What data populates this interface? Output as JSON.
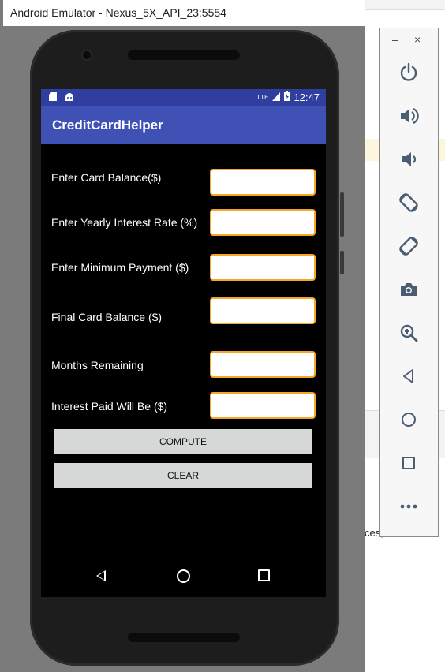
{
  "window": {
    "title": "Android Emulator - Nexus_5X_API_23:5554"
  },
  "status_bar": {
    "network": "LTE",
    "time": "12:47"
  },
  "app": {
    "title": "CreditCardHelper"
  },
  "form": {
    "card_balance": {
      "label": "Enter Card Balance($)",
      "value": ""
    },
    "interest_rate": {
      "label": "Enter Yearly Interest Rate (%)",
      "value": ""
    },
    "minimum_payment": {
      "label": "Enter Minimum Payment ($)",
      "value": ""
    },
    "final_balance": {
      "label": "Final Card Balance ($)",
      "value": ""
    },
    "months_remaining": {
      "label": "Months Remaining",
      "value": ""
    },
    "interest_paid": {
      "label": "Interest Paid Will Be ($)",
      "value": ""
    }
  },
  "buttons": {
    "compute": "COMPUTE",
    "clear": "CLEAR"
  },
  "tool_panel": {
    "minimize": "–",
    "close": "×",
    "tools": [
      "power-icon",
      "volume-up-icon",
      "volume-down-icon",
      "rotate-left-icon",
      "rotate-right-icon",
      "camera-icon",
      "zoom-icon",
      "back-icon",
      "home-icon",
      "overview-icon",
      "more-icon"
    ],
    "icon_color": "#4a5d73"
  },
  "background": {
    "truncated_text": "ces;"
  },
  "colors": {
    "status_bar": "#303f9f",
    "app_bar": "#3f51b5",
    "field_border": "#f5a623"
  }
}
